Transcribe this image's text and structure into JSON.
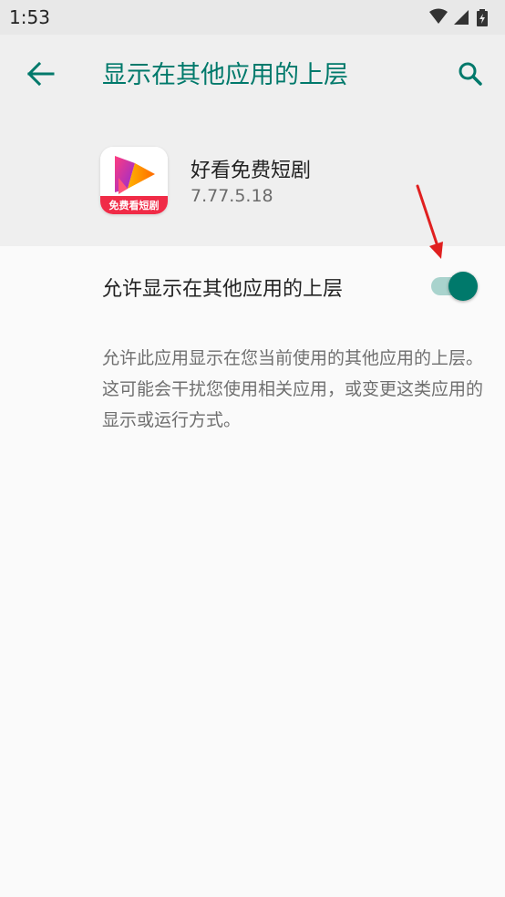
{
  "status_bar": {
    "time": "1:53",
    "icons": [
      "wifi-icon",
      "signal-icon",
      "battery-charging-icon"
    ]
  },
  "app_bar": {
    "title": "显示在其他应用的上层",
    "back_icon": "arrow-back-icon",
    "search_icon": "search-icon",
    "accent_color": "#00796b"
  },
  "app": {
    "name": "好看免费短剧",
    "version": "7.77.5.18",
    "icon_badge_text": "免费看短剧"
  },
  "setting": {
    "label": "允许显示在其他应用的上层",
    "enabled": true
  },
  "description": "允许此应用显示在您当前使用的其他应用的上层。这可能会干扰您使用相关应用，或变更这类应用的显示或运行方式。",
  "annotation": {
    "type": "red-arrow",
    "color": "#e02020"
  }
}
